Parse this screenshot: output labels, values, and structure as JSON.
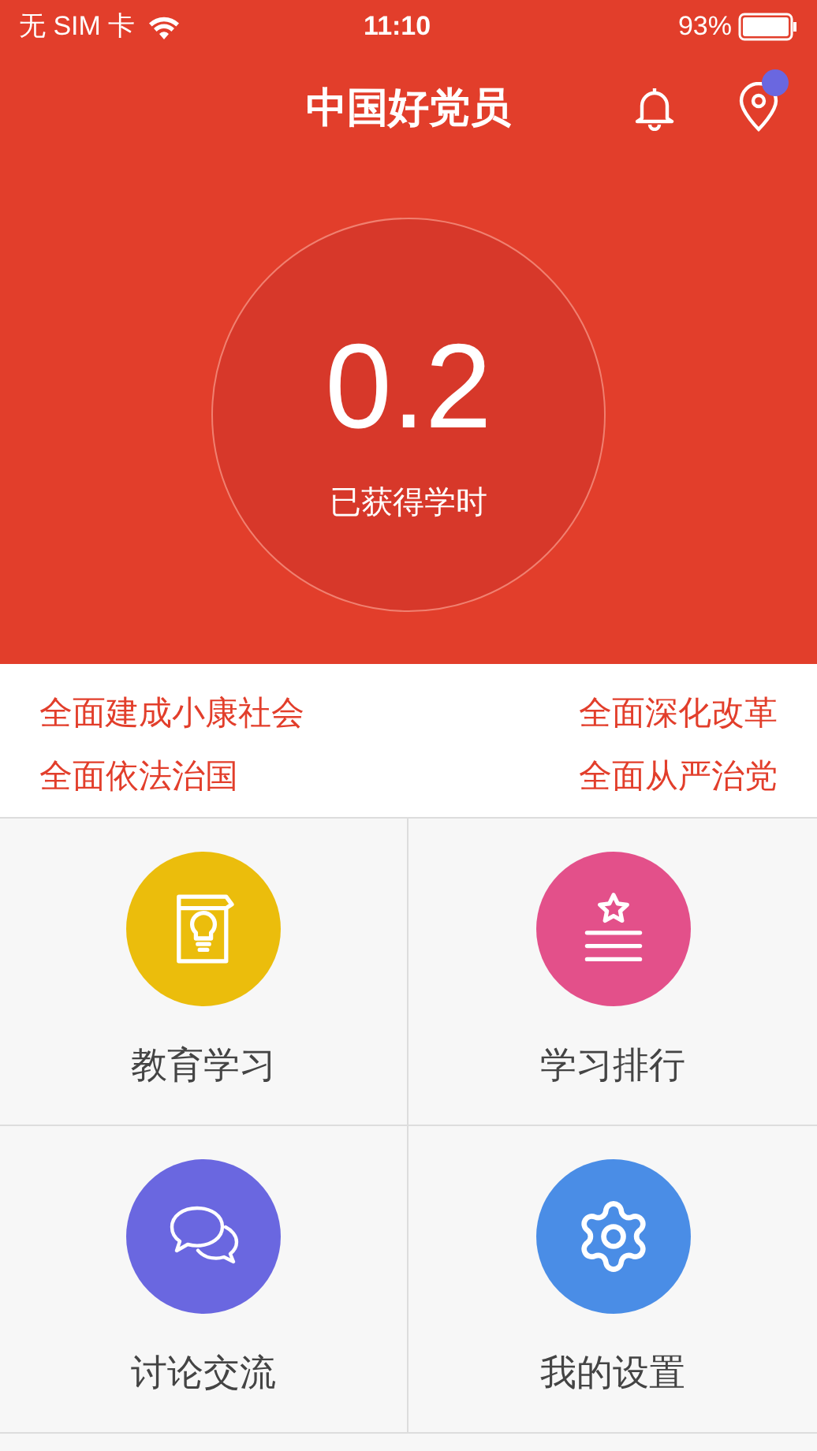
{
  "status_bar": {
    "carrier": "无 SIM 卡",
    "time": "11:10",
    "battery": "93%"
  },
  "header": {
    "title": "中国好党员",
    "location_badge": true
  },
  "score": {
    "value": "0.2",
    "label": "已获得学时"
  },
  "slogans": [
    "全面建成小康社会",
    "全面深化改革",
    "全面依法治国",
    "全面从严治党"
  ],
  "menu": [
    {
      "kind": "book",
      "label": "教育学习",
      "color": "#ebbd0c"
    },
    {
      "kind": "ranking",
      "label": "学习排行",
      "color": "#e3508a"
    },
    {
      "kind": "chat",
      "label": "讨论交流",
      "color": "#6a67e0"
    },
    {
      "kind": "settings",
      "label": "我的设置",
      "color": "#4a8de6"
    }
  ]
}
